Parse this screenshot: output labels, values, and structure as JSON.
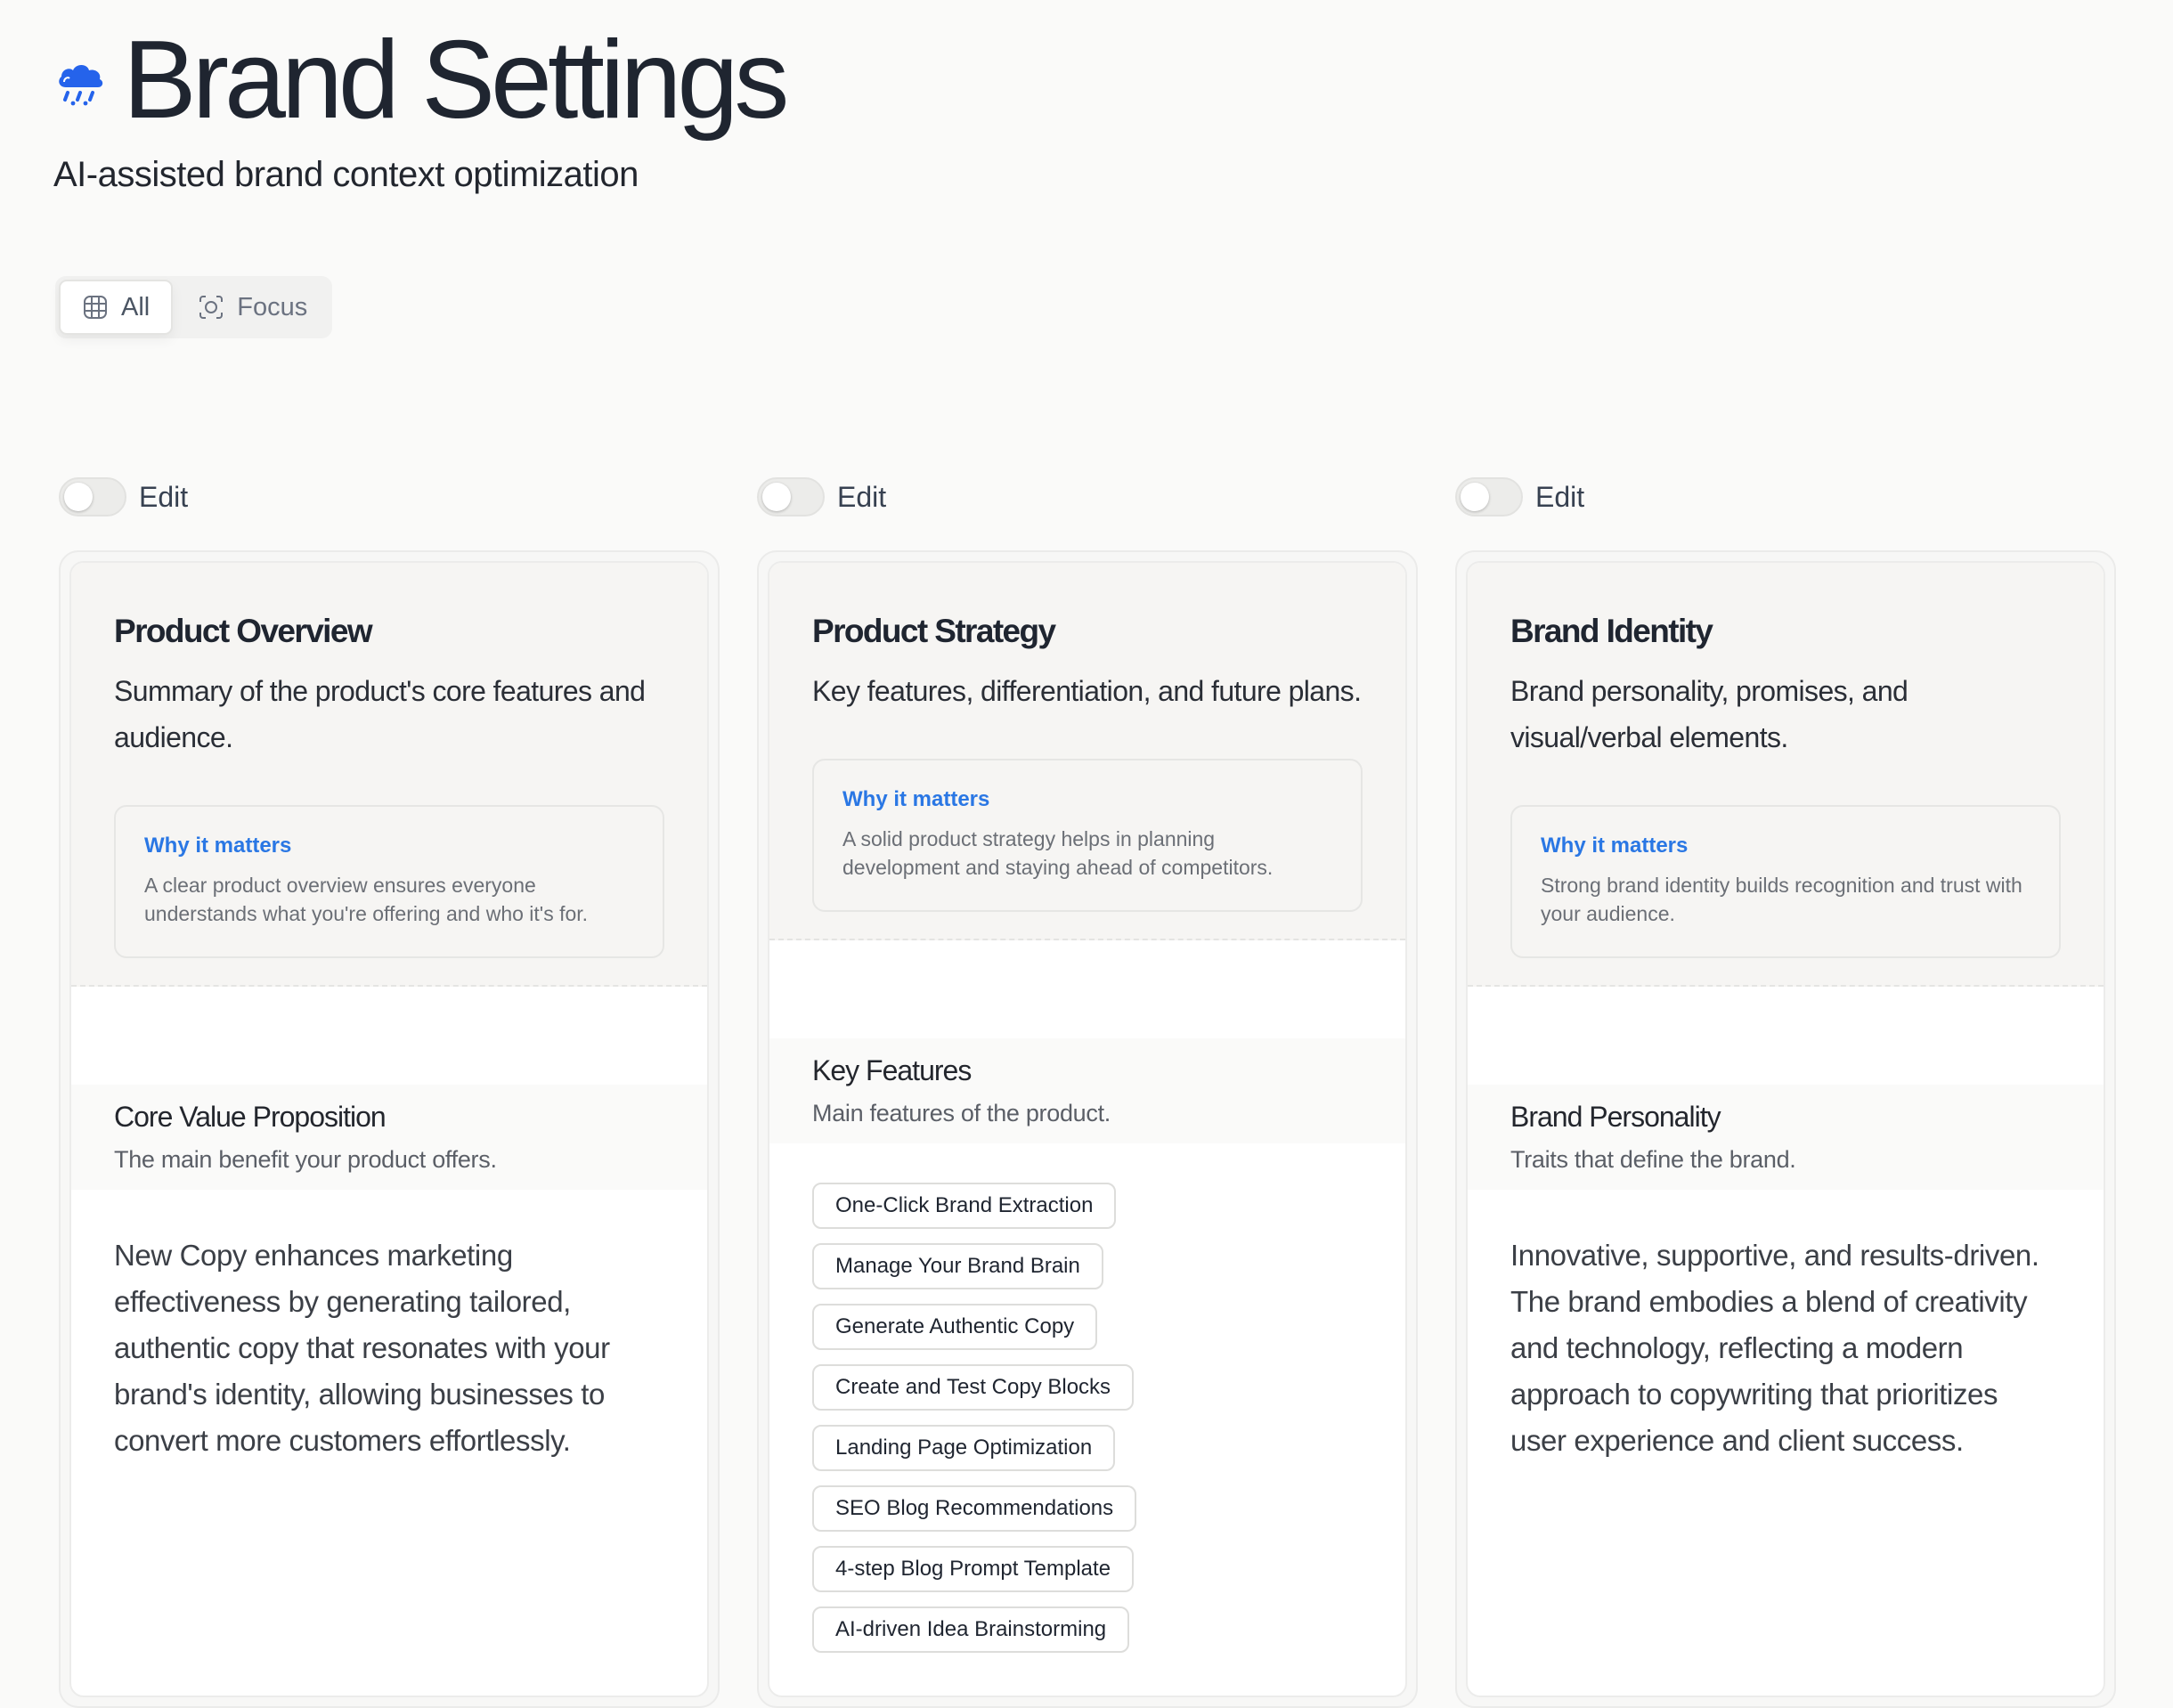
{
  "header": {
    "title": "Brand Settings",
    "subtitle": "AI-assisted brand context optimization",
    "logo_icon": "cloud-rain-icon",
    "accent": "#2563eb"
  },
  "view_toggle": {
    "options": [
      {
        "label": "All",
        "icon": "globe-grid-icon",
        "active": true
      },
      {
        "label": "Focus",
        "icon": "focus-target-icon",
        "active": false
      }
    ]
  },
  "columns": [
    {
      "edit_label": "Edit",
      "edit_on": false,
      "title": "Product Overview",
      "description": "Summary of the product's core features and audience.",
      "why_title": "Why it matters",
      "why_text": "A clear product overview ensures everyone understands what you're offering and who it's for.",
      "section_title": "Core Value Proposition",
      "section_sub": "The main benefit your product offers.",
      "section_body": "New Copy enhances marketing effectiveness by generating tailored, authentic copy that resonates with your brand's identity, allowing businesses to convert more customers effortlessly."
    },
    {
      "edit_label": "Edit",
      "edit_on": false,
      "title": "Product Strategy",
      "description": "Key features, differentiation, and future plans.",
      "why_title": "Why it matters",
      "why_text": "A solid product strategy helps in planning development and staying ahead of competitors.",
      "section_title": "Key Features",
      "section_sub": "Main features of the product.",
      "tags": [
        "One-Click Brand Extraction",
        "Manage Your Brand Brain",
        "Generate Authentic Copy",
        "Create and Test Copy Blocks",
        "Landing Page Optimization",
        "SEO Blog Recommendations",
        "4-step Blog Prompt Template",
        "AI-driven Idea Brainstorming"
      ]
    },
    {
      "edit_label": "Edit",
      "edit_on": false,
      "title": "Brand Identity",
      "description": "Brand personality, promises, and visual/verbal elements.",
      "why_title": "Why it matters",
      "why_text": "Strong brand identity builds recognition and trust with your audience.",
      "section_title": "Brand Personality",
      "section_sub": "Traits that define the brand.",
      "section_body": "Innovative, supportive, and results-driven. The brand embodies a blend of creativity and technology, reflecting a modern approach to copywriting that prioritizes user experience and client success."
    }
  ]
}
